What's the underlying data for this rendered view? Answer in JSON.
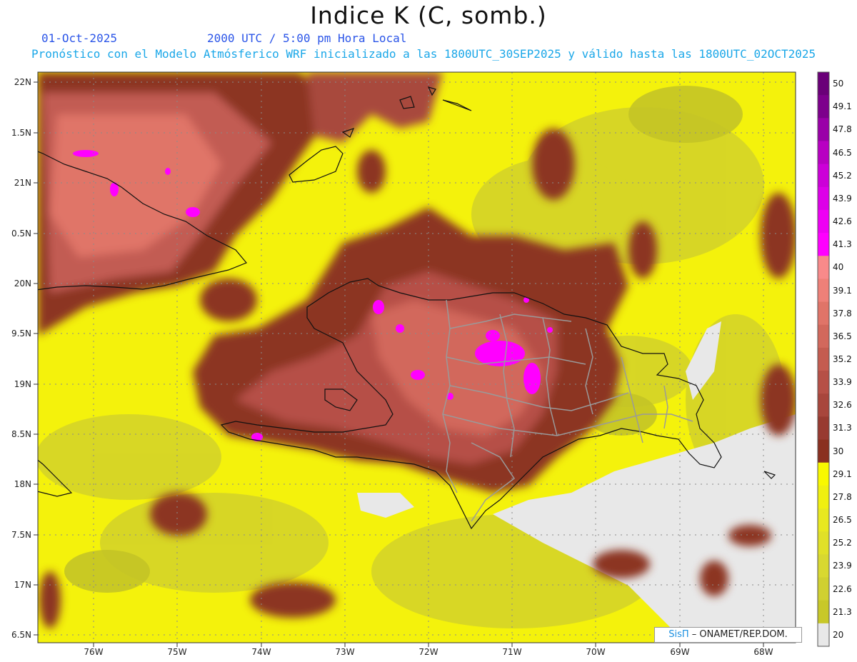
{
  "title": "Indice K (C, somb.)",
  "header": {
    "date": "01-Oct-2025",
    "time": "2000 UTC / 5:00 pm Hora Local",
    "forecast_note": "Pronóstico con el Modelo Atmósferico WRF inicializado a las 1800UTC_30SEP2025 y válido hasta las  1800UTC_02OCT2025"
  },
  "axes": {
    "lat_labels": [
      "22N",
      "1.5N",
      "21N",
      "0.5N",
      "20N",
      "9.5N",
      "19N",
      "8.5N",
      "18N",
      "7.5N",
      "17N",
      "6.5N"
    ],
    "lon_labels": [
      "76W",
      "75W",
      "74W",
      "73W",
      "72W",
      "71W",
      "70W",
      "69W",
      "68W"
    ]
  },
  "colorbar": {
    "labels": [
      "50",
      "49.1",
      "47.8",
      "46.5",
      "45.2",
      "43.9",
      "42.6",
      "41.3",
      "40",
      "39.1",
      "37.8",
      "36.5",
      "35.2",
      "33.9",
      "32.6",
      "31.3",
      "30",
      "29.1",
      "27.8",
      "26.5",
      "25.2",
      "23.9",
      "22.6",
      "21.3",
      "20"
    ],
    "colors": [
      "#6a0078",
      "#7d008c",
      "#9a00a8",
      "#b800c2",
      "#cc00d8",
      "#dd00e8",
      "#ee00f4",
      "#ff00ff",
      "#f88a8a",
      "#ee8078",
      "#e07468",
      "#d2685c",
      "#c45c50",
      "#b65046",
      "#a8463c",
      "#983a30",
      "#8a3020",
      "#f8f800",
      "#f0f010",
      "#e8e820",
      "#e0e028",
      "#d8d830",
      "#d0d030",
      "#c8c828",
      "#e8e8e8"
    ]
  },
  "credit": {
    "sis": "SisΠ",
    "text": "– ONAMET/REP.DOM."
  }
}
